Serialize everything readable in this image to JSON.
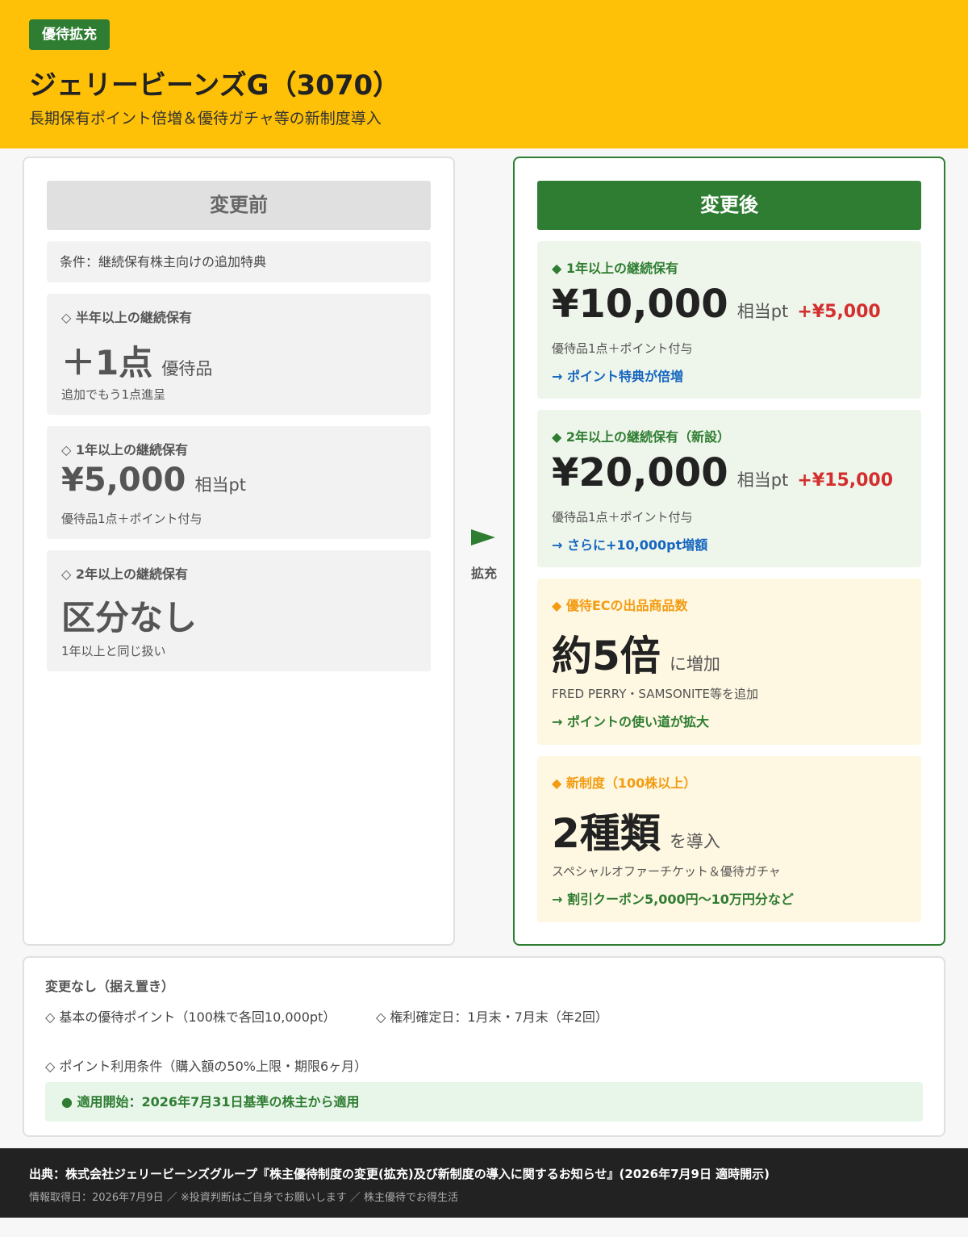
{
  "header": {
    "badge": "優待拡充",
    "title": "ジェリービーンズG（3070）",
    "subtitle": "長期保有ポイント倍増＆優待ガチャ等の新制度導入"
  },
  "before": {
    "heading": "変更前",
    "condition": "条件：継続保有株主向けの追加特典",
    "cards": [
      {
        "label": "◇ 半年以上の継続保有",
        "big": "＋1点",
        "unit": "優待品",
        "note": "追加でもう1点進呈"
      },
      {
        "label": "◇ 1年以上の継続保有",
        "big": "¥5,000",
        "unit": "相当pt",
        "note": "優待品1点＋ポイント付与"
      },
      {
        "label": "◇ 2年以上の継続保有",
        "big": "区分なし",
        "note": "1年以上と同じ扱い"
      }
    ]
  },
  "middle": {
    "arrow_label": "拡充"
  },
  "after": {
    "heading": "変更後",
    "cards": [
      {
        "label": "◆ 1年以上の継続保有",
        "big": "¥10,000",
        "unit": "相当pt",
        "delta": "+¥5,000",
        "note": "優待品1点＋ポイント付与",
        "arrow": "→ ポイント特典が倍増"
      },
      {
        "label": "◆ 2年以上の継続保有（新設）",
        "big": "¥20,000",
        "unit": "相当pt",
        "delta": "+¥15,000",
        "note": "優待品1点＋ポイント付与",
        "arrow": "→ さらに+10,000pt増額"
      },
      {
        "label": "◆ 優待ECの出品商品数",
        "big": "約5倍",
        "unit": "に増加",
        "note": "FRED PERRY・SAMSONITE等を追加",
        "arrow": "→ ポイントの使い道が拡大"
      },
      {
        "label": "◆ 新制度（100株以上）",
        "big": "2種類",
        "unit": "を導入",
        "note": "スペシャルオファーチケット＆優待ガチャ",
        "arrow": "→ 割引クーポン5,000円〜10万円分など"
      }
    ]
  },
  "unchanged": {
    "title": "変更なし（据え置き）",
    "items": [
      "◇ 基本の優待ポイント（100株で各回10,000pt）",
      "◇ 権利確定日：1月末・7月末（年2回）",
      "◇ ポイント利用条件（購入額の50%上限・期限6ヶ月）"
    ],
    "apply": "● 適用開始：2026年7月31日基準の株主から適用"
  },
  "footer": {
    "source": "出典：株式会社ジェリービーンズグループ『株主優待制度の変更(拡充)及び新制度の導入に関するお知らせ』(2026年7月9日 適時開示)",
    "info": "情報取得日：2026年7月9日 ／ ※投資判断はご自身でお願いします ／ 株主優待でお得生活"
  },
  "colors": {
    "header_bg": "#ffc107",
    "accent_green": "#2e7d32",
    "delta_red": "#d32f2f",
    "arrow_blue": "#1565c0",
    "label_orange": "#f39c12"
  }
}
